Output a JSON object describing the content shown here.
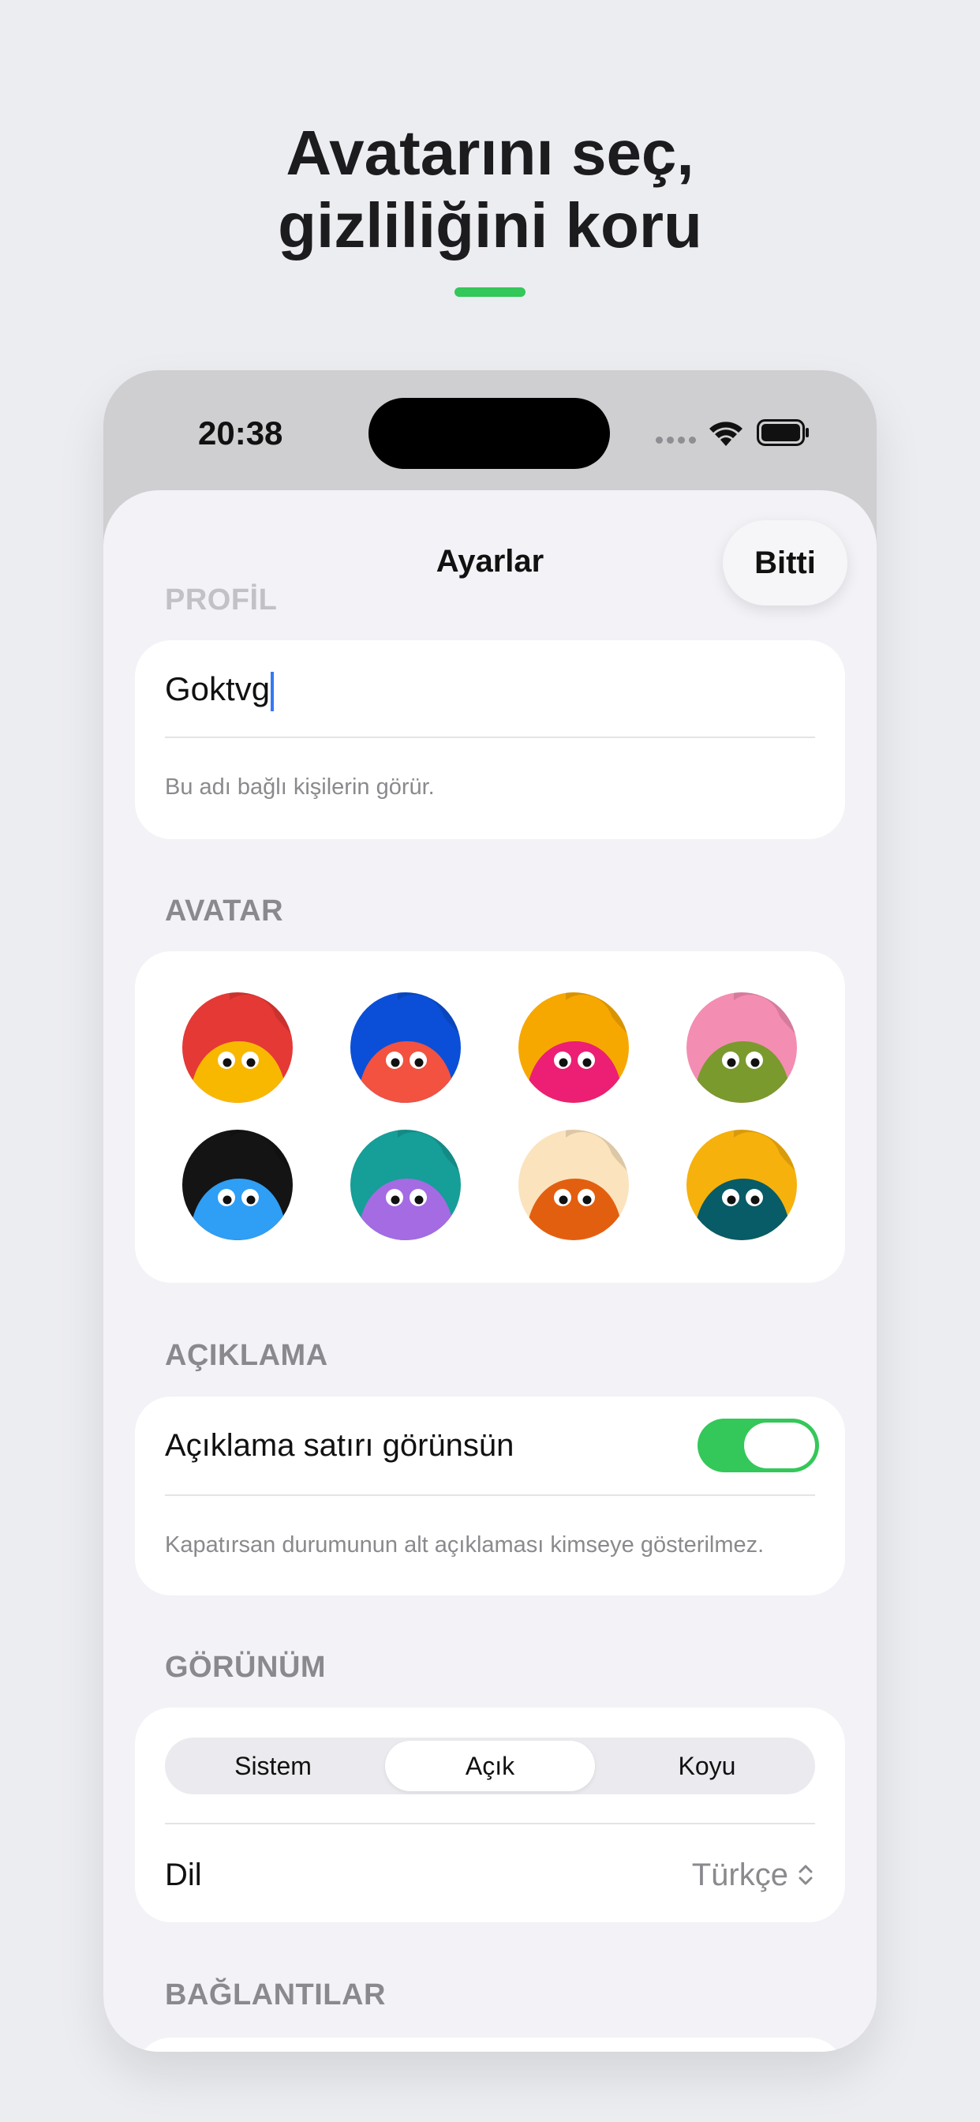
{
  "headline": {
    "line1": "Avatarını seç,",
    "line2": "gizliliğini koru"
  },
  "colors": {
    "accent": "#34C759",
    "toggle_on": "#34C759",
    "caret": "#3478F6"
  },
  "status_bar": {
    "time": "20:38",
    "icons": [
      "signal-dots-icon",
      "wifi-icon",
      "battery-icon"
    ]
  },
  "nav": {
    "title": "Ayarlar",
    "done_label": "Bitti"
  },
  "profile": {
    "section_label": "PROFİL",
    "name_value": "Goktvg",
    "footer": "Bu adı bağlı kişilerin görür."
  },
  "avatar": {
    "section_label": "AVATAR",
    "items": [
      {
        "name": "avatar-red-yellow",
        "bg": "#E53935",
        "body": "#F9B800"
      },
      {
        "name": "avatar-blue-coral",
        "bg": "#0B4FD8",
        "body": "#F2523F"
      },
      {
        "name": "avatar-orange-pink",
        "bg": "#F7A800",
        "body": "#EC1F74"
      },
      {
        "name": "avatar-pink-olive",
        "bg": "#F48DB2",
        "body": "#7A9A2E"
      },
      {
        "name": "avatar-black-blue",
        "bg": "#141414",
        "body": "#2F9EF5"
      },
      {
        "name": "avatar-teal-purple",
        "bg": "#169E98",
        "body": "#A46BE2"
      },
      {
        "name": "avatar-cream-orange",
        "bg": "#FBE3BD",
        "body": "#E35F10"
      },
      {
        "name": "avatar-yellow-teal",
        "bg": "#F6B10D",
        "body": "#075C67"
      }
    ]
  },
  "description": {
    "section_label": "AÇIKLAMA",
    "toggle_label": "Açıklama satırı görünsün",
    "toggle_on": true,
    "footer": "Kapatırsan durumunun alt açıklaması kimseye gösterilmez."
  },
  "appearance": {
    "section_label": "GÖRÜNÜM",
    "segments": [
      "Sistem",
      "Açık",
      "Koyu"
    ],
    "selected": "Açık",
    "language_label": "Dil",
    "language_value": "Türkçe"
  },
  "connections": {
    "section_label": "BAĞLANTILAR"
  }
}
